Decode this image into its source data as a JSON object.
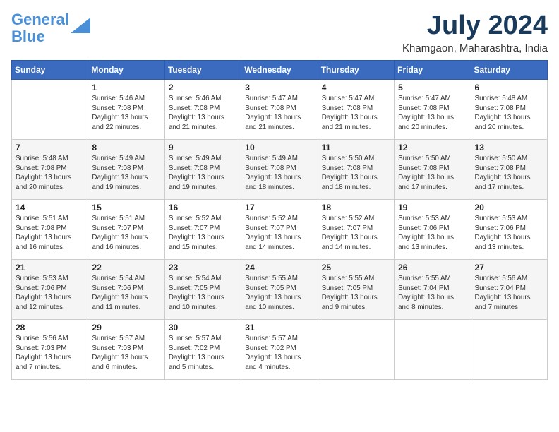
{
  "header": {
    "logo_line1": "General",
    "logo_line2": "Blue",
    "month_year": "July 2024",
    "location": "Khamgaon, Maharashtra, India"
  },
  "weekdays": [
    "Sunday",
    "Monday",
    "Tuesday",
    "Wednesday",
    "Thursday",
    "Friday",
    "Saturday"
  ],
  "weeks": [
    [
      {
        "day": "",
        "info": ""
      },
      {
        "day": "1",
        "info": "Sunrise: 5:46 AM\nSunset: 7:08 PM\nDaylight: 13 hours\nand 22 minutes."
      },
      {
        "day": "2",
        "info": "Sunrise: 5:46 AM\nSunset: 7:08 PM\nDaylight: 13 hours\nand 21 minutes."
      },
      {
        "day": "3",
        "info": "Sunrise: 5:47 AM\nSunset: 7:08 PM\nDaylight: 13 hours\nand 21 minutes."
      },
      {
        "day": "4",
        "info": "Sunrise: 5:47 AM\nSunset: 7:08 PM\nDaylight: 13 hours\nand 21 minutes."
      },
      {
        "day": "5",
        "info": "Sunrise: 5:47 AM\nSunset: 7:08 PM\nDaylight: 13 hours\nand 20 minutes."
      },
      {
        "day": "6",
        "info": "Sunrise: 5:48 AM\nSunset: 7:08 PM\nDaylight: 13 hours\nand 20 minutes."
      }
    ],
    [
      {
        "day": "7",
        "info": "Sunrise: 5:48 AM\nSunset: 7:08 PM\nDaylight: 13 hours\nand 20 minutes."
      },
      {
        "day": "8",
        "info": "Sunrise: 5:49 AM\nSunset: 7:08 PM\nDaylight: 13 hours\nand 19 minutes."
      },
      {
        "day": "9",
        "info": "Sunrise: 5:49 AM\nSunset: 7:08 PM\nDaylight: 13 hours\nand 19 minutes."
      },
      {
        "day": "10",
        "info": "Sunrise: 5:49 AM\nSunset: 7:08 PM\nDaylight: 13 hours\nand 18 minutes."
      },
      {
        "day": "11",
        "info": "Sunrise: 5:50 AM\nSunset: 7:08 PM\nDaylight: 13 hours\nand 18 minutes."
      },
      {
        "day": "12",
        "info": "Sunrise: 5:50 AM\nSunset: 7:08 PM\nDaylight: 13 hours\nand 17 minutes."
      },
      {
        "day": "13",
        "info": "Sunrise: 5:50 AM\nSunset: 7:08 PM\nDaylight: 13 hours\nand 17 minutes."
      }
    ],
    [
      {
        "day": "14",
        "info": "Sunrise: 5:51 AM\nSunset: 7:08 PM\nDaylight: 13 hours\nand 16 minutes."
      },
      {
        "day": "15",
        "info": "Sunrise: 5:51 AM\nSunset: 7:07 PM\nDaylight: 13 hours\nand 16 minutes."
      },
      {
        "day": "16",
        "info": "Sunrise: 5:52 AM\nSunset: 7:07 PM\nDaylight: 13 hours\nand 15 minutes."
      },
      {
        "day": "17",
        "info": "Sunrise: 5:52 AM\nSunset: 7:07 PM\nDaylight: 13 hours\nand 14 minutes."
      },
      {
        "day": "18",
        "info": "Sunrise: 5:52 AM\nSunset: 7:07 PM\nDaylight: 13 hours\nand 14 minutes."
      },
      {
        "day": "19",
        "info": "Sunrise: 5:53 AM\nSunset: 7:06 PM\nDaylight: 13 hours\nand 13 minutes."
      },
      {
        "day": "20",
        "info": "Sunrise: 5:53 AM\nSunset: 7:06 PM\nDaylight: 13 hours\nand 13 minutes."
      }
    ],
    [
      {
        "day": "21",
        "info": "Sunrise: 5:53 AM\nSunset: 7:06 PM\nDaylight: 13 hours\nand 12 minutes."
      },
      {
        "day": "22",
        "info": "Sunrise: 5:54 AM\nSunset: 7:06 PM\nDaylight: 13 hours\nand 11 minutes."
      },
      {
        "day": "23",
        "info": "Sunrise: 5:54 AM\nSunset: 7:05 PM\nDaylight: 13 hours\nand 10 minutes."
      },
      {
        "day": "24",
        "info": "Sunrise: 5:55 AM\nSunset: 7:05 PM\nDaylight: 13 hours\nand 10 minutes."
      },
      {
        "day": "25",
        "info": "Sunrise: 5:55 AM\nSunset: 7:05 PM\nDaylight: 13 hours\nand 9 minutes."
      },
      {
        "day": "26",
        "info": "Sunrise: 5:55 AM\nSunset: 7:04 PM\nDaylight: 13 hours\nand 8 minutes."
      },
      {
        "day": "27",
        "info": "Sunrise: 5:56 AM\nSunset: 7:04 PM\nDaylight: 13 hours\nand 7 minutes."
      }
    ],
    [
      {
        "day": "28",
        "info": "Sunrise: 5:56 AM\nSunset: 7:03 PM\nDaylight: 13 hours\nand 7 minutes."
      },
      {
        "day": "29",
        "info": "Sunrise: 5:57 AM\nSunset: 7:03 PM\nDaylight: 13 hours\nand 6 minutes."
      },
      {
        "day": "30",
        "info": "Sunrise: 5:57 AM\nSunset: 7:02 PM\nDaylight: 13 hours\nand 5 minutes."
      },
      {
        "day": "31",
        "info": "Sunrise: 5:57 AM\nSunset: 7:02 PM\nDaylight: 13 hours\nand 4 minutes."
      },
      {
        "day": "",
        "info": ""
      },
      {
        "day": "",
        "info": ""
      },
      {
        "day": "",
        "info": ""
      }
    ]
  ]
}
